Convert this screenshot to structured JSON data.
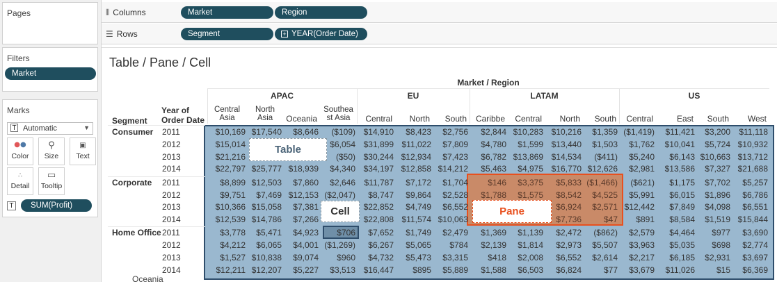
{
  "sidebar": {
    "pages_title": "Pages",
    "filters_title": "Filters",
    "filter_pill": "Market",
    "marks_title": "Marks",
    "mark_type": "Automatic",
    "mark_buttons": [
      "Color",
      "Size",
      "Text",
      "Detail",
      "Tooltip"
    ],
    "measure_pill": "SUM(Profit)"
  },
  "shelves": {
    "columns_label": "Columns",
    "columns_pills": [
      "Market",
      "Region"
    ],
    "rows_label": "Rows",
    "rows_pills": [
      "Segment",
      "YEAR(Order Date)"
    ]
  },
  "view": {
    "title": "Table / Pane / Cell",
    "market_region_header": "Market / Region",
    "segment_header": "Segment",
    "year_header_line1": "Year of",
    "year_header_line2": "Order Date",
    "markets": [
      "APAC",
      "EU",
      "LATAM",
      "US"
    ],
    "regions": [
      [
        "Central",
        "Asia"
      ],
      [
        "North",
        "Asia"
      ],
      [
        "Oceania",
        ""
      ],
      [
        "Southea",
        "st Asia"
      ],
      [
        "Central",
        ""
      ],
      [
        "North",
        ""
      ],
      [
        "South",
        ""
      ],
      [
        "Caribbe",
        ""
      ],
      [
        "Central",
        ""
      ],
      [
        "North",
        ""
      ],
      [
        "South",
        ""
      ],
      [
        "Central",
        ""
      ],
      [
        "East",
        ""
      ],
      [
        "South",
        ""
      ],
      [
        "West",
        ""
      ]
    ],
    "segments": [
      "Consumer",
      "Corporate",
      "Home Office"
    ],
    "years": [
      "2011",
      "2012",
      "2013",
      "2014"
    ],
    "cells": [
      [
        "$10,169",
        "$17,540",
        "$8,646",
        "($109)",
        "$14,910",
        "$8,423",
        "$2,756",
        "$2,844",
        "$10,283",
        "$10,216",
        "$1,359",
        "($1,419)",
        "$11,421",
        "$3,200",
        "$11,118"
      ],
      [
        "$15,014",
        "",
        "",
        "$6,054",
        "$31,899",
        "$11,022",
        "$7,809",
        "$4,780",
        "$1,599",
        "$13,440",
        "$1,503",
        "$1,762",
        "$10,041",
        "$5,724",
        "$10,932"
      ],
      [
        "$21,216",
        "",
        "",
        "($50)",
        "$30,244",
        "$12,934",
        "$7,423",
        "$6,782",
        "$13,869",
        "$14,534",
        "($411)",
        "$5,240",
        "$6,143",
        "$10,663",
        "$13,712"
      ],
      [
        "$22,797",
        "$25,777",
        "$18,939",
        "$4,340",
        "$34,197",
        "$12,858",
        "$14,212",
        "$5,463",
        "$4,975",
        "$16,770",
        "$12,626",
        "$2,981",
        "$13,586",
        "$7,327",
        "$21,688"
      ],
      [
        "$8,899",
        "$12,503",
        "$7,860",
        "$2,646",
        "$11,787",
        "$7,172",
        "$1,704",
        "$146",
        "$3,375",
        "$5,833",
        "($1,466)",
        "($621)",
        "$1,175",
        "$7,702",
        "$5,257"
      ],
      [
        "$9,751",
        "$7,469",
        "$12,153",
        "($2,047)",
        "$8,747",
        "$9,864",
        "$2,528",
        "$1,788",
        "$1,575",
        "$8,542",
        "$4,525",
        "$5,991",
        "$6,015",
        "$1,896",
        "$6,786"
      ],
      [
        "$10,366",
        "$15,058",
        "$7,381",
        "",
        "$22,852",
        "$4,749",
        "$6,552",
        "",
        "",
        "$6,924",
        "$2,571",
        "$12,442",
        "$7,849",
        "$4,098",
        "$6,551"
      ],
      [
        "$12,539",
        "$14,786",
        "$7,266",
        "",
        "$22,808",
        "$11,574",
        "$10,063",
        "",
        "",
        "$7,736",
        "$47",
        "$891",
        "$8,584",
        "$1,519",
        "$15,844"
      ],
      [
        "$3,778",
        "$5,471",
        "$4,923",
        "$706",
        "$7,652",
        "$1,749",
        "$2,479",
        "$1,369",
        "$1,139",
        "$2,472",
        "($862)",
        "$2,579",
        "$4,464",
        "$977",
        "$3,690"
      ],
      [
        "$4,212",
        "$6,065",
        "$4,001",
        "($1,269)",
        "$6,267",
        "$5,065",
        "$784",
        "$2,139",
        "$1,814",
        "$2,973",
        "$5,507",
        "$3,963",
        "$5,035",
        "$698",
        "$2,774"
      ],
      [
        "$1,527",
        "$10,838",
        "$9,074",
        "$960",
        "$4,732",
        "$5,473",
        "$3,315",
        "$418",
        "$2,008",
        "$6,552",
        "$2,614",
        "$2,217",
        "$6,185",
        "$2,931",
        "$3,697"
      ],
      [
        "$12,211",
        "$12,207",
        "$5,227",
        "$3,513",
        "$16,447",
        "$895",
        "$5,889",
        "$1,588",
        "$6,503",
        "$6,824",
        "$77",
        "$3,679",
        "$11,026",
        "$15",
        "$6,369"
      ]
    ],
    "callouts": {
      "table": "Table",
      "cell": "Cell",
      "pane": "Pane"
    },
    "tooltip_fragment": "Oceania"
  },
  "colors": {
    "pill": "#1f4e5e",
    "table_fill": "#9ab8cf",
    "table_border": "#2e4d6b",
    "pane_fill": "#c98a68",
    "pane_border": "#e8501e",
    "cell_fill": "#6f8fa8"
  }
}
